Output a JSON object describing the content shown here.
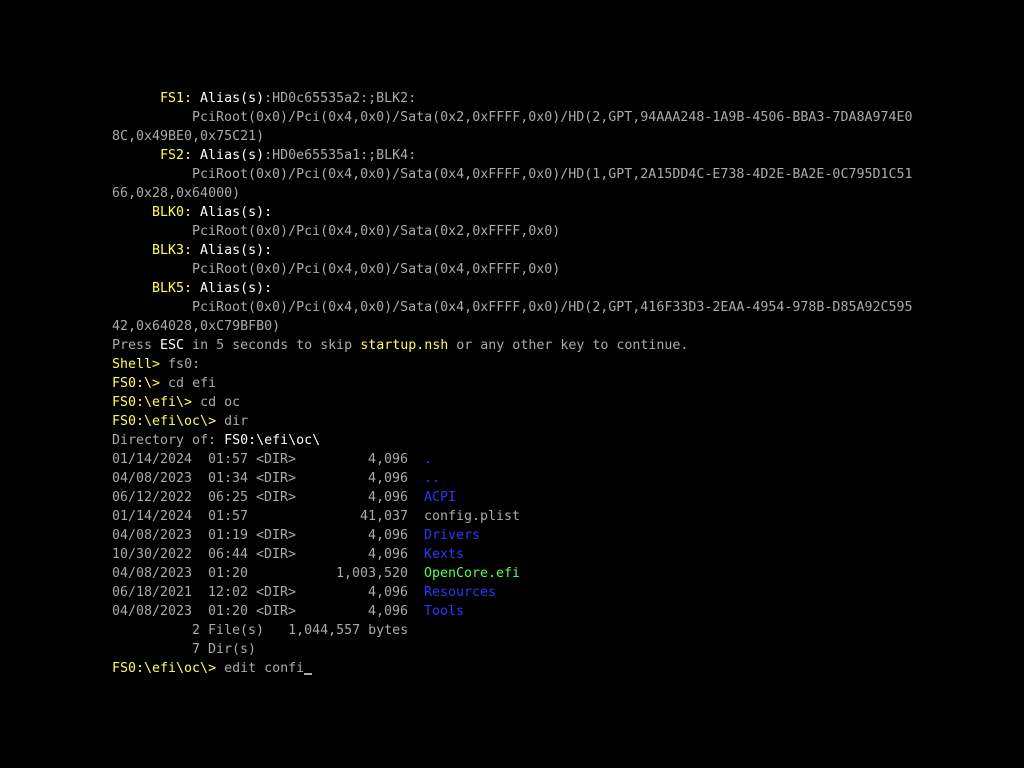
{
  "map": {
    "fs1": {
      "name": "FS1:",
      "alias_label": "Alias(s)",
      "alias_value": ":HD0c65535a2:;BLK2:",
      "path_1": "PciRoot(0x0)/Pci(0x4,0x0)/Sata(0x2,0xFFFF,0x0)/HD(2,GPT,94AAA248-1A9B-4506-BBA3-7DA8A974E0",
      "path_2": "8C,0x49BE0,0x75C21)"
    },
    "fs2": {
      "name": "FS2:",
      "alias_label": "Alias(s)",
      "alias_value": ":HD0e65535a1:;BLK4:",
      "path_1": "PciRoot(0x0)/Pci(0x4,0x0)/Sata(0x4,0xFFFF,0x0)/HD(1,GPT,2A15DD4C-E738-4D2E-BA2E-0C795D1C51",
      "path_2": "66,0x28,0x64000)"
    },
    "blk0": {
      "name": "BLK0:",
      "alias_label": "Alias(s)",
      "alias_value": ":",
      "path_1": "PciRoot(0x0)/Pci(0x4,0x0)/Sata(0x2,0xFFFF,0x0)"
    },
    "blk3": {
      "name": "BLK3:",
      "alias_label": "Alias(s)",
      "alias_value": ":",
      "path_1": "PciRoot(0x0)/Pci(0x4,0x0)/Sata(0x4,0xFFFF,0x0)"
    },
    "blk5": {
      "name": "BLK5:",
      "alias_label": "Alias(s)",
      "alias_value": ":",
      "path_1": "PciRoot(0x0)/Pci(0x4,0x0)/Sata(0x4,0xFFFF,0x0)/HD(2,GPT,416F33D3-2EAA-4954-978B-D85A92C595",
      "path_2": "42,0x64028,0xC79BFB0)"
    }
  },
  "startup": {
    "text_1": "Press ",
    "esc": "ESC",
    "text_2": " in 5 seconds to skip ",
    "script": "startup.nsh",
    "text_3": " or any other key to continue."
  },
  "commands": [
    {
      "prompt": "Shell>",
      "command": " fs0:"
    },
    {
      "prompt": "FS0:\\>",
      "command": " cd efi"
    },
    {
      "prompt": "FS0:\\efi\\>",
      "command": " cd oc"
    },
    {
      "prompt": "FS0:\\efi\\oc\\>",
      "command": " dir"
    }
  ],
  "directory": {
    "label": "Directory of: ",
    "path": "FS0:\\efi\\oc\\",
    "entries": [
      {
        "date": "01/14/2024",
        "time": "01:57",
        "type": "<DIR>",
        "size": "4,096",
        "name": ".",
        "color": "#3333ff"
      },
      {
        "date": "04/08/2023",
        "time": "01:34",
        "type": "<DIR>",
        "size": "4,096",
        "name": "..",
        "color": "#3333ff"
      },
      {
        "date": "06/12/2022",
        "time": "06:25",
        "type": "<DIR>",
        "size": "4,096",
        "name": "ACPI",
        "color": "#3333ff"
      },
      {
        "date": "01/14/2024",
        "time": "01:57",
        "type": "",
        "size": "41,037",
        "name": "config.plist",
        "color": "#aaaaaa"
      },
      {
        "date": "04/08/2023",
        "time": "01:19",
        "type": "<DIR>",
        "size": "4,096",
        "name": "Drivers",
        "color": "#3333ff"
      },
      {
        "date": "10/30/2022",
        "time": "06:44",
        "type": "<DIR>",
        "size": "4,096",
        "name": "Kexts",
        "color": "#3333ff"
      },
      {
        "date": "04/08/2023",
        "time": "01:20",
        "type": "",
        "size": "1,003,520",
        "name": "OpenCore.efi",
        "color": "#55ff55"
      },
      {
        "date": "06/18/2021",
        "time": "12:02",
        "type": "<DIR>",
        "size": "4,096",
        "name": "Resources",
        "color": "#3333ff"
      },
      {
        "date": "04/08/2023",
        "time": "01:20",
        "type": "<DIR>",
        "size": "4,096",
        "name": "Tools",
        "color": "#3333ff"
      }
    ],
    "files_summary": "2 File(s)   1,044,557 bytes",
    "dirs_summary": "7 Dir(s)"
  },
  "current": {
    "prompt": "FS0:\\efi\\oc\\>",
    "input": " edit confi"
  }
}
